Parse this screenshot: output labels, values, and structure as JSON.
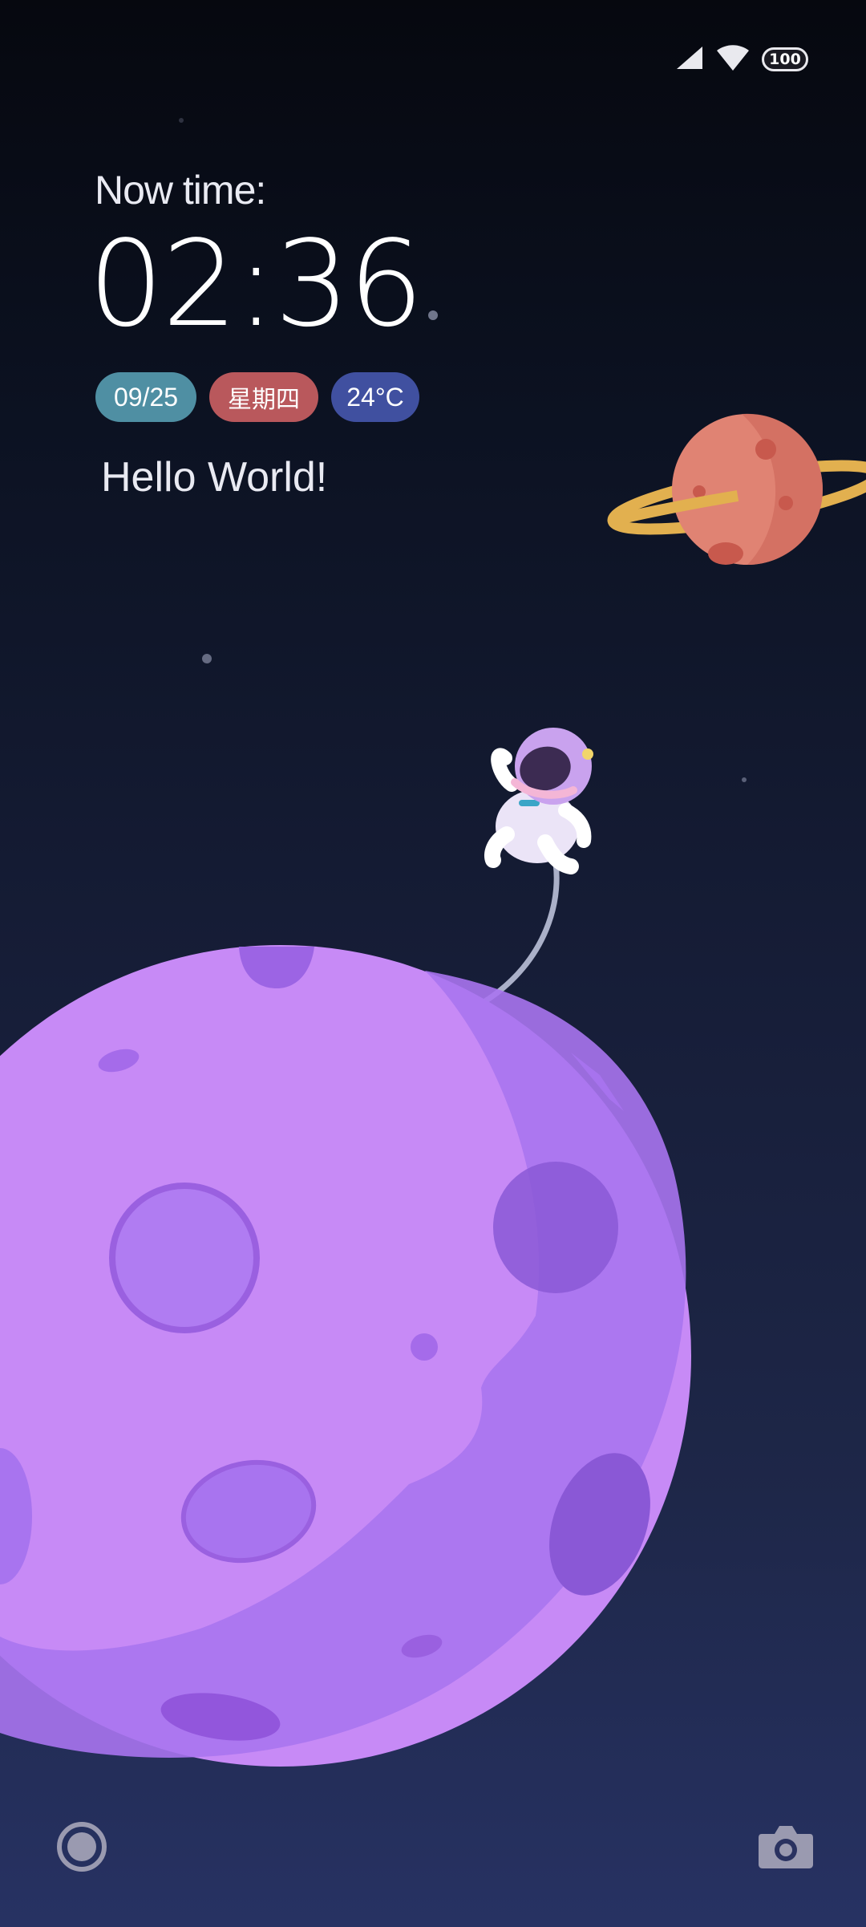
{
  "status_bar": {
    "icons": [
      "signal-icon",
      "wifi-icon",
      "battery-icon"
    ],
    "battery_level": "100"
  },
  "clock": {
    "label": "Now time:",
    "time": "02:36"
  },
  "chips": {
    "date": "09/25",
    "weekday": "星期四",
    "temperature": "24°C"
  },
  "greeting": "Hello World!",
  "shortcuts": {
    "left_icon": "assistant-ring-icon",
    "right_icon": "camera-icon"
  },
  "colors": {
    "chip_date": "#4f8fa3",
    "chip_weekday": "#b9585c",
    "chip_temperature": "#4050a0",
    "moon": "#c78af6",
    "planet": "#e08373"
  }
}
